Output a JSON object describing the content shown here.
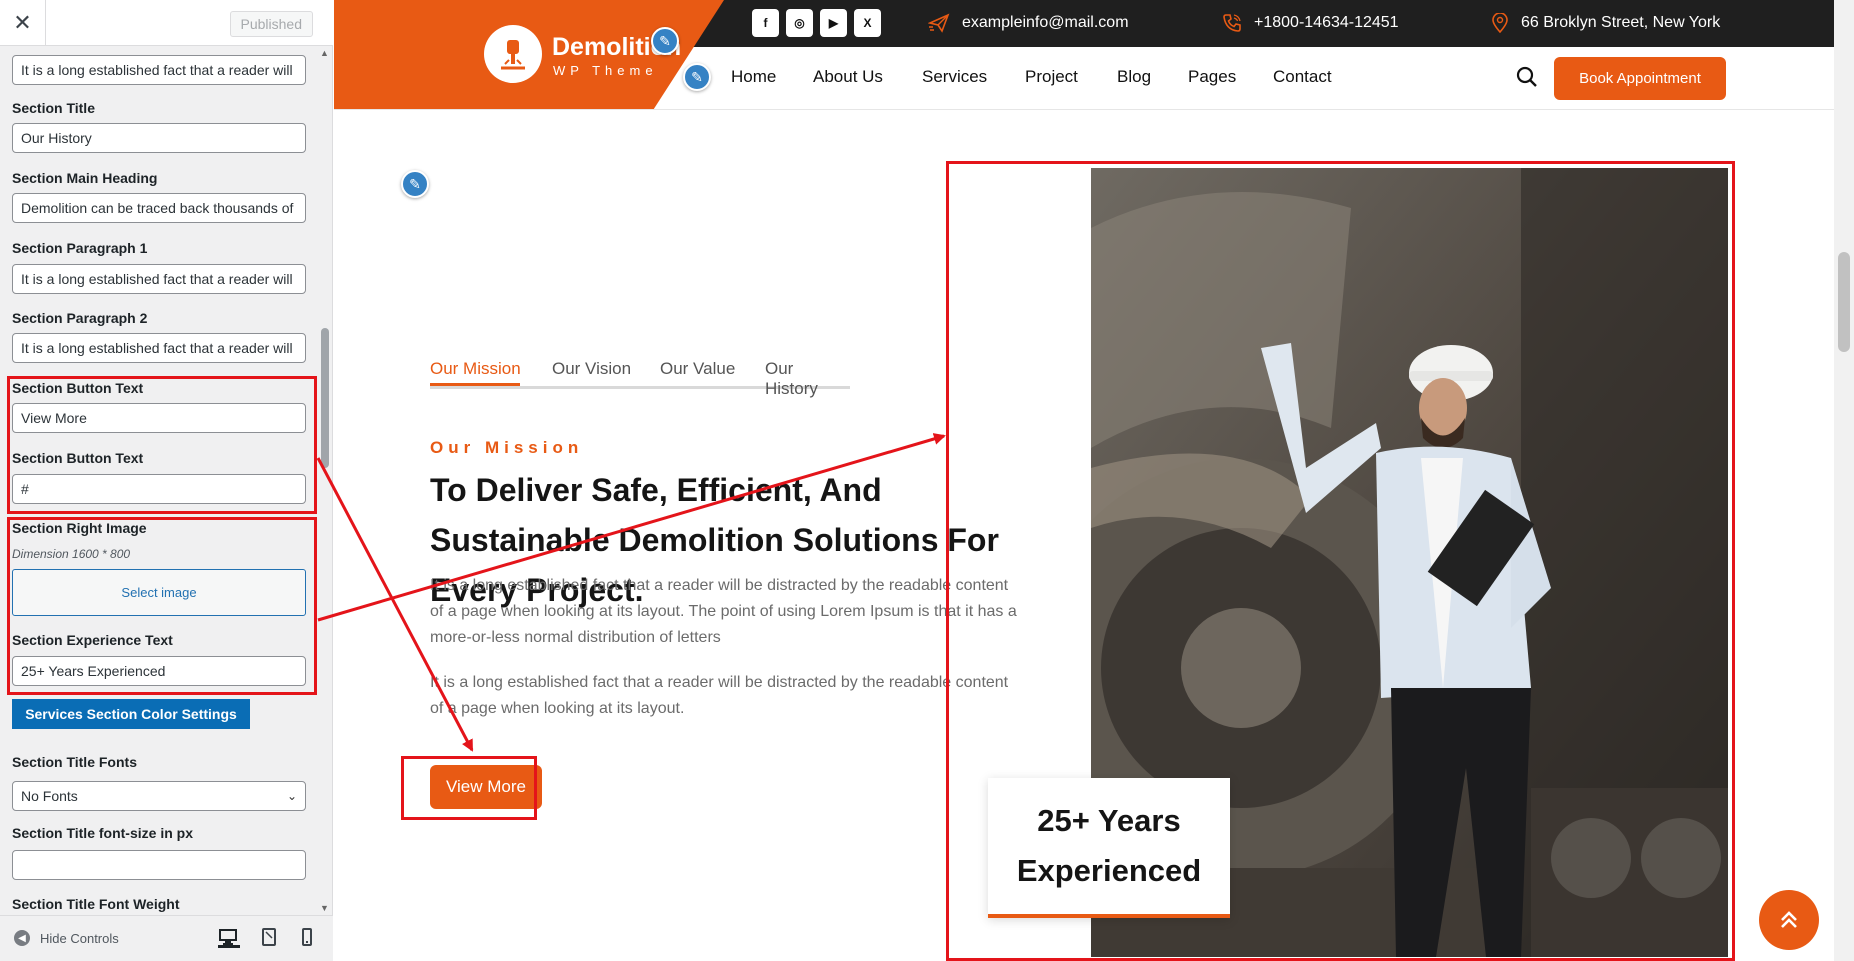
{
  "customizer": {
    "close_label": "✕",
    "published_label": "Published",
    "fields": [
      {
        "label": "",
        "value": "It is a long established fact that a reader will"
      },
      {
        "label": "Section Title",
        "value": "Our History"
      },
      {
        "label": "Section Main Heading",
        "value": "Demolition can be traced back thousands of"
      },
      {
        "label": "Section Paragraph 1",
        "value": "It is a long established fact that a reader will"
      },
      {
        "label": "Section Paragraph 2",
        "value": "It is a long established fact that a reader will"
      },
      {
        "label": "Section Button Text",
        "value": "View More"
      },
      {
        "label": "Section Button Text",
        "value": "#"
      },
      {
        "label": "Section Right Image",
        "value": ""
      },
      {
        "label": "Section Experience Text",
        "value": "25+ Years Experienced"
      }
    ],
    "image_dimension": "Dimension 1600 * 800",
    "select_image_label": "Select image",
    "services_color_button": "Services Section Color Settings",
    "title_fonts_label": "Section Title Fonts",
    "title_fonts_value": "No Fonts",
    "title_font_size_label": "Section Title font-size in px",
    "title_font_size_value": "",
    "title_font_weight_label": "Section Title Font Weight",
    "hide_controls_label": "Hide Controls"
  },
  "site": {
    "logo_title": "Demolition",
    "logo_subtitle": "WP Theme",
    "social": [
      "f",
      "◎",
      "▶",
      "X"
    ],
    "email": "exampleinfo@mail.com",
    "phone": "+1800-14634-12451",
    "address": "66 Broklyn Street, New York",
    "nav": [
      "Home",
      "About Us",
      "Services",
      "Project",
      "Blog",
      "Pages",
      "Contact"
    ],
    "book_label": "Book Appointment",
    "tabs": [
      "Our Mission",
      "Our Vision",
      "Our Value",
      "Our History"
    ],
    "active_tab": "Our Mission",
    "mission_subtitle": "Our Mission",
    "mission_heading": "To Deliver Safe, Efficient, And Sustainable Demolition Solutions For Every Project.",
    "paragraph1": "It is a long established fact that a reader will be distracted by the readable content of a page when looking at its layout. The point of using Lorem Ipsum is that it has a more-or-less normal distribution of letters",
    "paragraph2": "It is a long established fact that a reader will be distracted by the readable content of a page when looking at its layout.",
    "view_more_label": "View More",
    "experience_text": "25+ Years Experienced"
  },
  "colors": {
    "accent": "#e85a14",
    "topbar": "#1f1f1f",
    "highlight": "#e4141a",
    "wp_blue": "#2271b1"
  }
}
